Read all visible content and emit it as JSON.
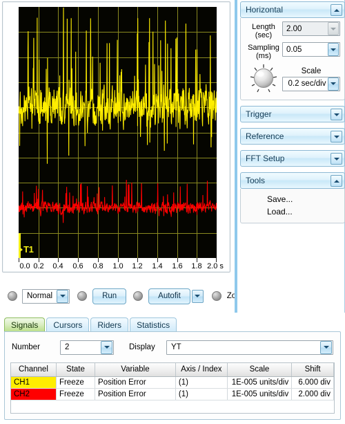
{
  "scope": {
    "trigger_marker": "T1",
    "x_axis": {
      "ticks": [
        "0.0",
        "0.2",
        "0.4",
        "0.6",
        "0.8",
        "1.0",
        "1.2",
        "1.4",
        "1.6",
        "1.8",
        "2.0"
      ],
      "unit": "s"
    }
  },
  "chart_data": {
    "type": "line",
    "title": "",
    "xlabel": "s",
    "ylabel": "",
    "xlim": [
      0.0,
      2.0
    ],
    "grid": true,
    "grid_divisions_x": 10,
    "grid_divisions_y": 10,
    "background": "#050500",
    "gridcolor": "#8a8a20",
    "legend": "none",
    "series": [
      {
        "name": "CH1",
        "color": "#FFEE00",
        "label": "Position Error",
        "center_div": 6.0,
        "scale": "1E-005 units/div",
        "noise_amplitude_div": 2.0
      },
      {
        "name": "CH2",
        "color": "#FF0000",
        "label": "Position Error",
        "center_div": 2.0,
        "scale": "1E-005 units/div",
        "noise_amplitude_div": 0.6
      }
    ]
  },
  "controls": {
    "mode": {
      "label": "Normal",
      "icon": "chevron-down-icon"
    },
    "run": {
      "label": "Run"
    },
    "autofit": {
      "label": "Autofit",
      "icon": "chevron-down-icon"
    },
    "zoom": {
      "label": "Zoom"
    }
  },
  "side": {
    "horizontal": {
      "title": "Horizontal",
      "toggle_icon": "chevron-up-icon",
      "length_label": "Length\n(sec)",
      "length_label_1": "Length",
      "length_label_2": "(sec)",
      "length_value": "2.00",
      "sampling_label_1": "Sampling",
      "sampling_label_2": "(ms)",
      "sampling_value": "0.05",
      "scale_label": "Scale",
      "scale_value": "0.2 sec/div",
      "knob_icon": "rotary-knob-icon"
    },
    "trigger": {
      "title": "Trigger",
      "toggle_icon": "chevron-down-icon"
    },
    "reference": {
      "title": "Reference",
      "toggle_icon": "chevron-down-icon"
    },
    "fft_setup": {
      "title": "FFT Setup",
      "toggle_icon": "chevron-down-icon"
    },
    "tools": {
      "title": "Tools",
      "toggle_icon": "chevron-up-icon",
      "items": [
        {
          "label": "Save..."
        },
        {
          "label": "Load..."
        }
      ]
    }
  },
  "bottom": {
    "tabs": [
      {
        "label": "Signals",
        "active": true
      },
      {
        "label": "Cursors",
        "active": false
      },
      {
        "label": "Riders",
        "active": false
      },
      {
        "label": "Statistics",
        "active": false
      }
    ],
    "number_label": "Number",
    "number_value": "2",
    "display_label": "Display",
    "display_value": "YT",
    "table": {
      "headers": [
        "Channel",
        "State",
        "Variable",
        "Axis / Index",
        "Scale",
        "Shift"
      ],
      "rows": [
        {
          "channel": "CH1",
          "channel_color": "#FFEE00",
          "state": "Freeze",
          "variable": "Position Error",
          "axis_index": "(1)",
          "scale": "1E-005 units/div",
          "shift": "6.000 div"
        },
        {
          "channel": "CH2",
          "channel_color": "#FF0000",
          "state": "Freeze",
          "variable": "Position Error",
          "axis_index": "(1)",
          "scale": "1E-005 units/div",
          "shift": "2.000 div"
        }
      ]
    }
  }
}
